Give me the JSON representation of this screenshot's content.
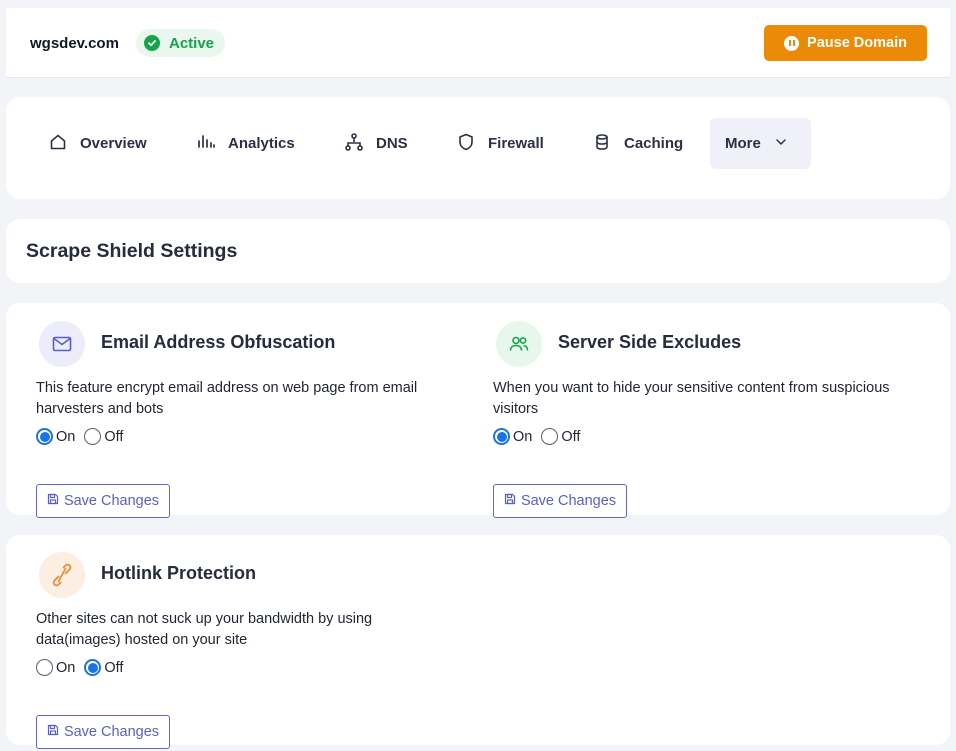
{
  "header": {
    "domain": "wgsdev.com",
    "status": "Active",
    "pause_label": "Pause Domain"
  },
  "nav": {
    "items": [
      {
        "label": "Overview",
        "icon": "home-icon"
      },
      {
        "label": "Analytics",
        "icon": "analytics-icon"
      },
      {
        "label": "DNS",
        "icon": "dns-icon"
      },
      {
        "label": "Firewall",
        "icon": "shield-icon"
      },
      {
        "label": "Caching",
        "icon": "database-icon"
      }
    ],
    "more_label": "More"
  },
  "page": {
    "title": "Scrape Shield Settings"
  },
  "features": [
    {
      "title": "Email Address Obfuscation",
      "description": "This feature encrypt email address on web page from email harvesters and bots",
      "selected": "On",
      "icon": "mail-icon",
      "save_label": "Save Changes"
    },
    {
      "title": "Server Side Excludes",
      "description": "When you want to hide your sensitive content from suspicious visitors",
      "selected": "On",
      "icon": "users-icon",
      "save_label": "Save Changes"
    },
    {
      "title": "Hotlink Protection",
      "description": "Other sites can not suck up your bandwidth by using data(images) hosted on your site",
      "selected": "Off",
      "icon": "link-icon",
      "save_label": "Save Changes"
    }
  ],
  "radio_labels": {
    "on": "On",
    "off": "Off"
  },
  "colors": {
    "accent": "#ea8a07",
    "active_green": "#16a34a",
    "button_outline": "#5a5fc6",
    "radio_selected": "#1a73e8"
  }
}
